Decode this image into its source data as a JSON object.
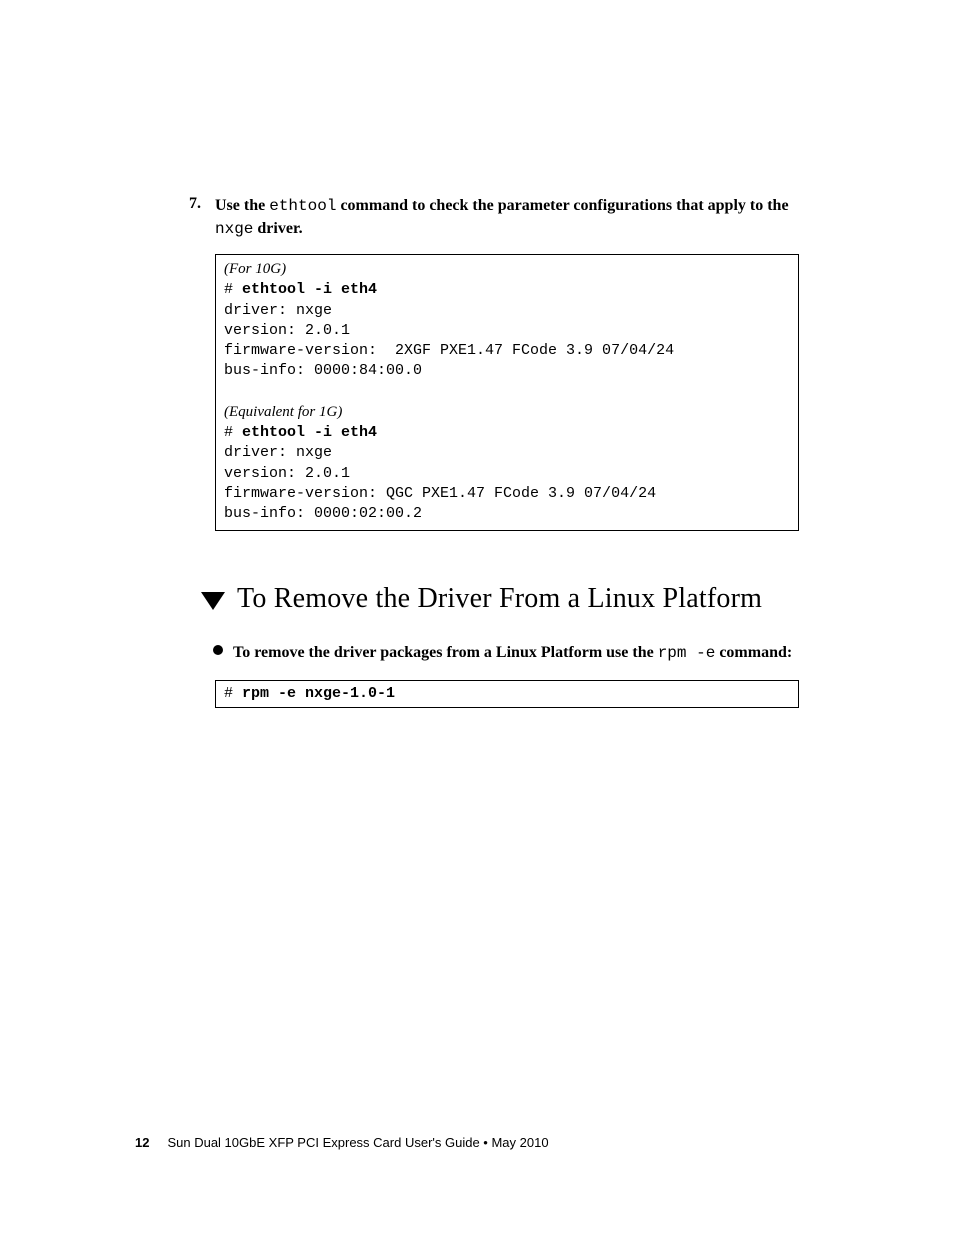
{
  "step": {
    "number": "7.",
    "part1": "Use the ",
    "code1": "ethtool",
    "part2": " command to check the parameter configurations that apply to the ",
    "code2": "nxge",
    "part3": " driver."
  },
  "codebox": {
    "label10g": "(For 10G)",
    "prompt1": "# ",
    "cmd1": "ethtool -i eth4",
    "out1a": "driver: nxge",
    "out1b": "version: 2.0.1",
    "out1c": "firmware-version:  2XGF PXE1.47 FCode 3.9 07/04/24",
    "out1d": "bus-info: 0000:84:00.0",
    "label1g": "(Equivalent for 1G)",
    "prompt2": "# ",
    "cmd2": "ethtool -i eth4",
    "out2a": "driver: nxge",
    "out2b": "version: 2.0.1",
    "out2c": "firmware-version: QGC PXE1.47 FCode 3.9 07/04/24",
    "out2d": "bus-info: 0000:02:00.2"
  },
  "heading": "To Remove the Driver From a Linux Platform",
  "bullet": {
    "part1": "To remove the driver packages from a Linux Platform use the ",
    "code": "rpm -e",
    "part2": " command:"
  },
  "cmdbox": {
    "prompt": "# ",
    "cmd": "rpm -e nxge-1.0-1"
  },
  "footer": {
    "page": "12",
    "title": "Sun Dual 10GbE XFP PCI Express Card User's Guide  •  May 2010"
  }
}
